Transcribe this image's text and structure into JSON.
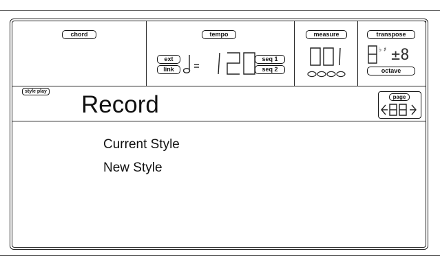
{
  "panels": {
    "chord": {
      "label": "chord"
    },
    "tempo": {
      "label": "tempo",
      "ext_label": "ext",
      "link_label": "link",
      "equals": "=",
      "value": "120",
      "seq1_label": "seq 1",
      "seq2_label": "seq 2"
    },
    "measure": {
      "label": "measure",
      "value": "001"
    },
    "transpose": {
      "label": "transpose",
      "value": "±8",
      "octave_label": "octave"
    }
  },
  "mode": {
    "tag": "style play",
    "title": "Record"
  },
  "page": {
    "label": "page",
    "value": "88"
  },
  "list": {
    "items": [
      "Current Style",
      "New Style"
    ]
  }
}
